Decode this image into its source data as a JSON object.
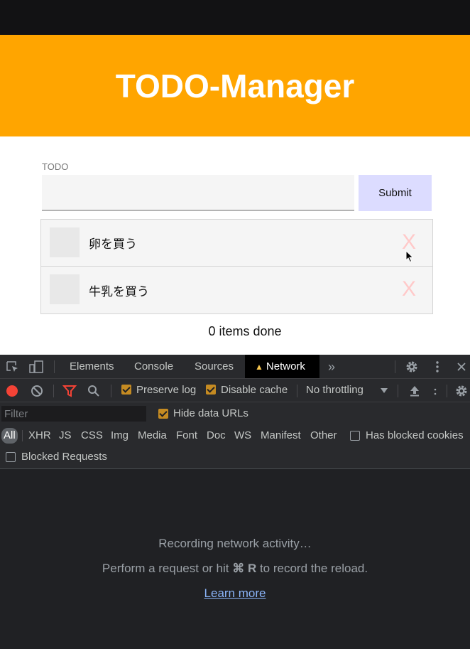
{
  "app": {
    "title": "TODO-Manager",
    "input_label": "TODO",
    "input_value": "",
    "submit_label": "Submit",
    "todos": [
      {
        "text": "卵を買う",
        "delete_glyph": "X"
      },
      {
        "text": "牛乳を買う",
        "delete_glyph": "X"
      }
    ],
    "done_count": "0 items done"
  },
  "devtools": {
    "tabs": [
      "Elements",
      "Console",
      "Sources",
      "Network"
    ],
    "active_tab": "Network",
    "toolbar": {
      "preserve_log": "Preserve log",
      "disable_cache": "Disable cache",
      "throttling": "No throttling"
    },
    "filter": {
      "placeholder": "Filter",
      "hide_data_urls": "Hide data URLs",
      "types": [
        "All",
        "XHR",
        "JS",
        "CSS",
        "Img",
        "Media",
        "Font",
        "Doc",
        "WS",
        "Manifest",
        "Other"
      ],
      "has_blocked_cookies": "Has blocked cookies",
      "blocked_requests": "Blocked Requests"
    },
    "empty": {
      "recording": "Recording network activity…",
      "hint_before": "Perform a request or hit ",
      "hint_keys": "⌘ R",
      "hint_after": " to record the reload.",
      "learn_more": "Learn more"
    }
  },
  "colors": {
    "header_bg": "#ffa500",
    "submit_bg": "#dcdcff",
    "delete_color": "#ffc9c9",
    "devtools_bg": "#202124",
    "checkbox_on": "#c58b22",
    "record_red": "#f44336",
    "link_blue": "#8ab4f8"
  }
}
